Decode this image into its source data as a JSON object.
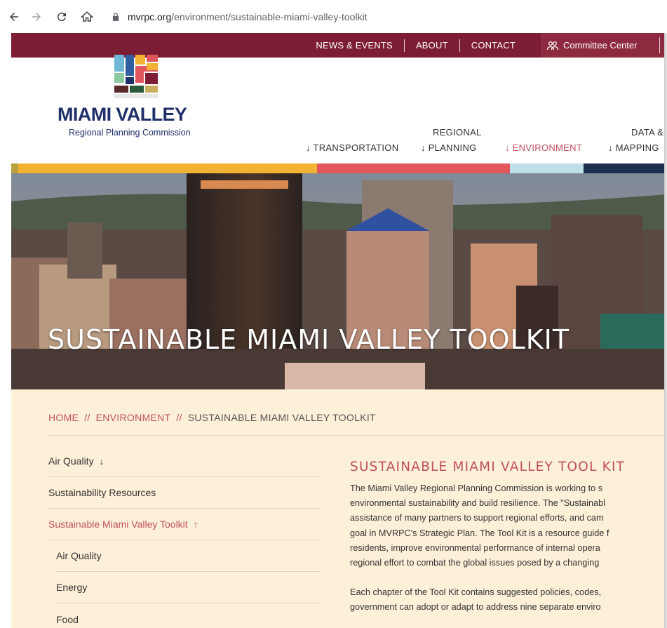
{
  "browser": {
    "url_host": "mvrpc.org",
    "url_path": "/environment/sustainable-miami-valley-toolkit"
  },
  "topbar": {
    "links": [
      "NEWS & EVENTS",
      "ABOUT",
      "CONTACT"
    ],
    "committee_label": "Committee Center"
  },
  "logo": {
    "title": "MIAMI VALLEY",
    "subtitle": "Regional Planning Commission"
  },
  "nav": {
    "transportation": "↓ TRANSPORTATION",
    "regional_top": "REGIONAL",
    "regional_bottom": "↓ PLANNING",
    "environment": "↓ ENVIRONMENT",
    "data_top": "DATA &",
    "data_bottom": "↓ MAPPING"
  },
  "colors": {
    "topbar": "#7c1d34",
    "accent": "#c05060",
    "navy": "#1f2f6a",
    "cream": "#fdf0d9"
  },
  "hero": {
    "title": "SUSTAINABLE MIAMI VALLEY TOOLKIT"
  },
  "breadcrumb": {
    "home": "HOME",
    "sep": "//",
    "environment": "ENVIRONMENT",
    "current": "SUSTAINABLE MIAMI VALLEY TOOLKIT"
  },
  "sidebar": {
    "items": [
      {
        "label": "Air Quality",
        "arrow": "↓"
      },
      {
        "label": "Sustainability Resources",
        "arrow": ""
      },
      {
        "label": "Sustainable Miami Valley Toolkit",
        "arrow": "↑"
      }
    ],
    "sub_items": [
      {
        "label": "Air Quality"
      },
      {
        "label": "Energy"
      },
      {
        "label": "Food"
      }
    ]
  },
  "main": {
    "title": "SUSTAINABLE MIAMI VALLEY TOOL KIT",
    "para1": [
      "The Miami Valley Regional Planning Commission is working to s",
      "environmental sustainability and build resilience. The \"Sustainabl",
      "assistance of many partners to support regional efforts, and cam",
      "goal in MVRPC's Strategic Plan. The Tool Kit is a resource guide f",
      "residents, improve environmental performance of internal opera",
      "regional effort to combat the global issues posed by a changing"
    ],
    "para2": [
      "Each chapter of the Tool Kit contains suggested policies, codes,",
      "government can adopt or adapt to address nine separate enviro"
    ]
  }
}
